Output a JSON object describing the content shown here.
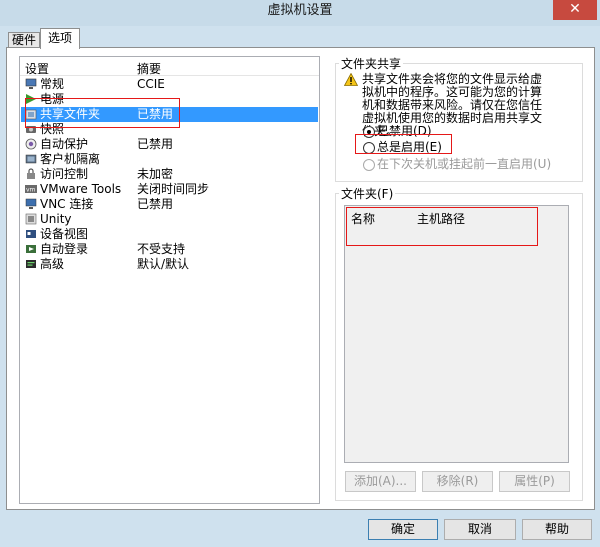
{
  "window": {
    "title": "虚拟机设置",
    "close_glyph": "✕"
  },
  "tabs": [
    {
      "label": "硬件"
    },
    {
      "label": "选项"
    }
  ],
  "settings_list": {
    "header_setting": "设置",
    "header_summary": "摘要",
    "items": [
      {
        "label": "常规",
        "summary": "CCIE",
        "icon": "monitor-icon",
        "selected": false
      },
      {
        "label": "电源",
        "summary": "",
        "icon": "power-play-icon",
        "selected": false
      },
      {
        "label": "共享文件夹",
        "summary": "已禁用",
        "icon": "shared-folder-icon",
        "selected": true
      },
      {
        "label": "快照",
        "summary": "",
        "icon": "snapshot-icon",
        "selected": false
      },
      {
        "label": "自动保护",
        "summary": "已禁用",
        "icon": "autoprotect-icon",
        "selected": false
      },
      {
        "label": "客户机隔离",
        "summary": "",
        "icon": "guest-isolation-icon",
        "selected": false
      },
      {
        "label": "访问控制",
        "summary": "未加密",
        "icon": "access-control-icon",
        "selected": false
      },
      {
        "label": "VMware Tools",
        "summary": "关闭时间同步",
        "icon": "vmware-tools-icon",
        "selected": false
      },
      {
        "label": "VNC 连接",
        "summary": "已禁用",
        "icon": "vnc-icon",
        "selected": false
      },
      {
        "label": "Unity",
        "summary": "",
        "icon": "unity-icon",
        "selected": false
      },
      {
        "label": "设备视图",
        "summary": "",
        "icon": "device-view-icon",
        "selected": false
      },
      {
        "label": "自动登录",
        "summary": "不受支持",
        "icon": "autologin-icon",
        "selected": false
      },
      {
        "label": "高级",
        "summary": "默认/默认",
        "icon": "advanced-icon",
        "selected": false
      }
    ]
  },
  "folder_sharing": {
    "title": "文件夹共享",
    "warning": "共享文件夹会将您的文件显示给虚拟机中的程序。这可能为您的计算机和数据带来风险。请仅在您信任虚拟机使用您的数据时启用共享文件夹。",
    "options": [
      {
        "label": "已禁用(D)",
        "checked": true,
        "enabled": true
      },
      {
        "label": "总是启用(E)",
        "checked": false,
        "enabled": true
      },
      {
        "label": "在下次关机或挂起前一直启用(U)",
        "checked": false,
        "enabled": false
      }
    ]
  },
  "folders": {
    "title": "文件夹(F)",
    "columns": [
      "名称",
      "主机路径"
    ],
    "buttons": {
      "add": "添加(A)...",
      "remove": "移除(R)",
      "properties": "属性(P)"
    }
  },
  "footer": {
    "ok": "确定",
    "cancel": "取消",
    "help": "帮助"
  }
}
